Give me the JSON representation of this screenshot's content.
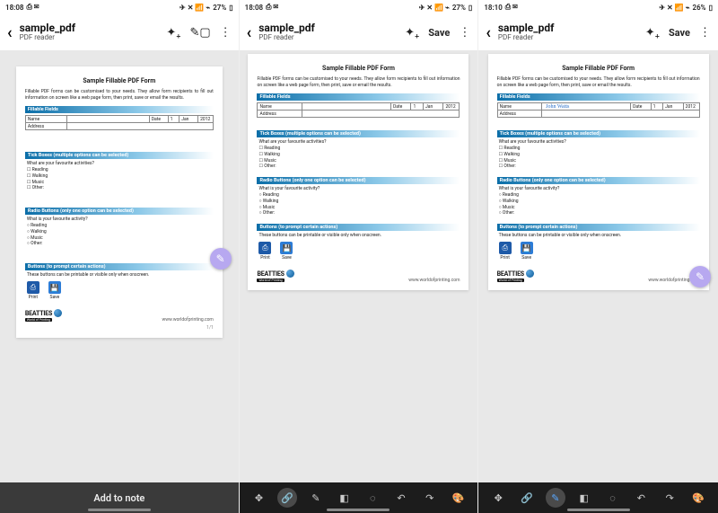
{
  "status": {
    "time_a": "18:08",
    "time_b": "18:08",
    "time_c": "18:10",
    "batt_a": "27%",
    "batt_b": "27%",
    "batt_c": "26%",
    "icons_left": "⎙ ✉",
    "icons_right": "✈ ✕ 📶 ⌁"
  },
  "app": {
    "title": "sample_pdf",
    "subtitle": "PDF reader",
    "save": "Save"
  },
  "doc": {
    "title": "Sample Fillable PDF Form",
    "intro": "Fillable PDF forms can be customised to your needs. They allow form recipients to fill out information on screen like a web page form, then print, save or email the results.",
    "fields_hdr": "Fillable Fields",
    "name_lbl": "Name",
    "addr_lbl": "Address",
    "date_lbl": "Date",
    "date_day": "1",
    "date_month": "Jan",
    "date_year": "2012",
    "signature": "John Watts",
    "tick_hdr": "Tick Boxes (multiple options can be selected)",
    "tick_q": "What are your favourite activities?",
    "opts": [
      "Reading",
      "Walking",
      "Music",
      "Other:"
    ],
    "opt_prefix_chk": "☐ ",
    "opt_prefix_rad": "○ ",
    "radio_hdr": "Radio Buttons (only one option can be selected)",
    "radio_q": "What is your favourite activity?",
    "btn_hdr": "Buttons (to prompt certain actions)",
    "btn_note": "These buttons can be printable or visible only when onscreen.",
    "print": "Print",
    "save": "Save",
    "logo": "BEATTIES",
    "logo_sub": "World of Printing",
    "url": "www.worldofprinting.com",
    "page_num": "1/1"
  },
  "bottom": {
    "add_note": "Add to note"
  }
}
